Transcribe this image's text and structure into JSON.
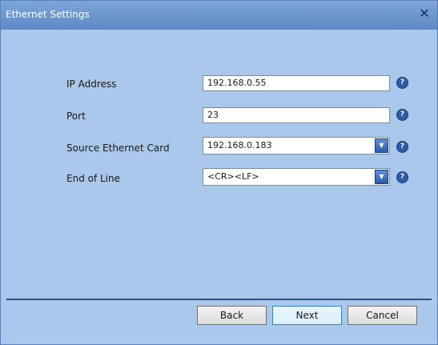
{
  "window": {
    "title": "Ethernet Settings",
    "close_glyph": "✕"
  },
  "form": {
    "ip_address": {
      "label": "IP Address",
      "value": "192.168.0.55"
    },
    "port": {
      "label": "Port",
      "value": "23"
    },
    "source_card": {
      "label": "Source Ethernet Card",
      "value": "192.168.0.183"
    },
    "end_of_line": {
      "label": "End of Line",
      "value": "<CR><LF>"
    }
  },
  "help_glyph": "?",
  "dropdown_glyph": "▼",
  "buttons": {
    "back": "Back",
    "next": "Next",
    "cancel": "Cancel"
  },
  "icons": [
    "close-icon",
    "help-icon",
    "chevron-down-icon"
  ],
  "colors": {
    "titlebar": "#6f97cf",
    "background": "#a9c8eb",
    "help": "#2a5caa",
    "divider": "#2f4f7f"
  }
}
